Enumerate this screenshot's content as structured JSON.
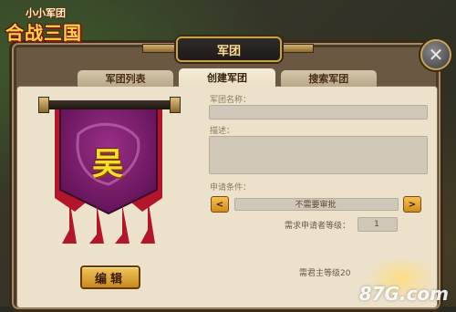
{
  "logo": {
    "top_text": "小小军团",
    "main_text": "合战三国"
  },
  "dialog": {
    "title": "军团",
    "close_symbol": "✕"
  },
  "tabs": [
    {
      "label": "军团列表",
      "active": false
    },
    {
      "label": "创建军团",
      "active": true
    },
    {
      "label": "搜索军团",
      "active": false
    }
  ],
  "banner": {
    "emblem_char": "吴",
    "color": "#7a1e6e",
    "tassel_color": "#b3152a"
  },
  "edit_button": {
    "label": "编辑"
  },
  "form": {
    "name_label": "军团名称：",
    "name_value": "",
    "desc_label": "描述：",
    "desc_value": "",
    "condition_label": "申请条件：",
    "condition_value": "不需要审批",
    "prev_symbol": "<",
    "next_symbol": ">",
    "level_label": "需求申请者等级：",
    "level_value": "1",
    "leader_level_text": "需君主等级20"
  },
  "watermark": "87G.com"
}
